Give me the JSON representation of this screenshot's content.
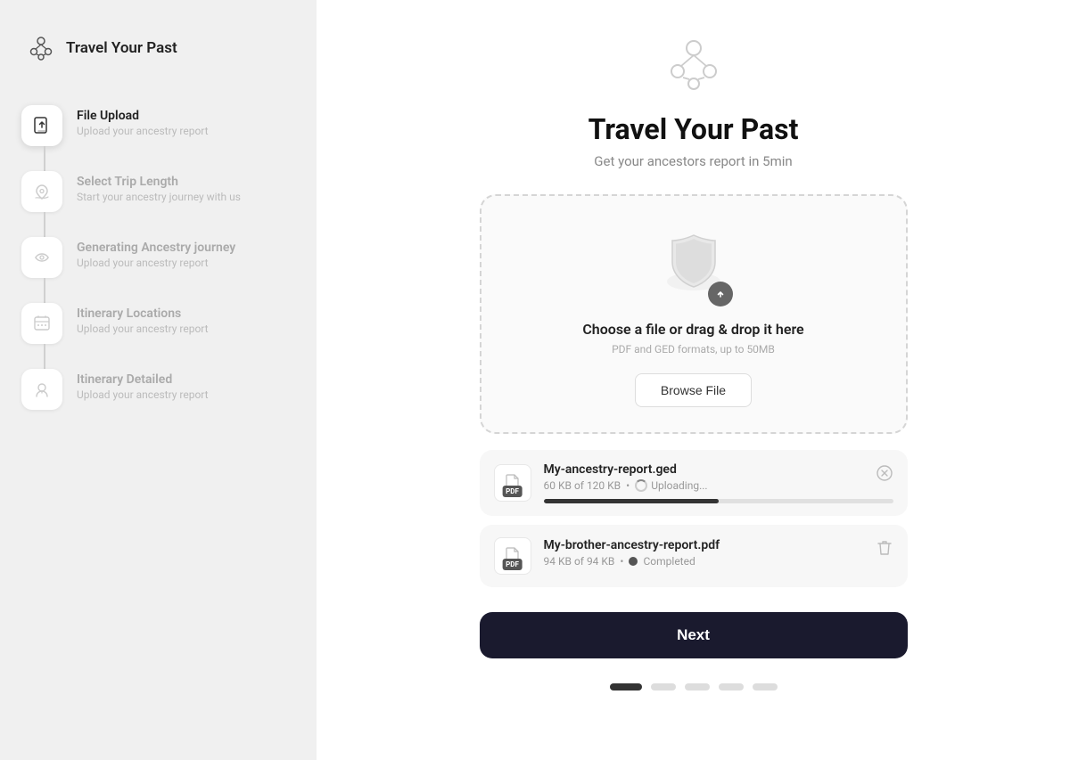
{
  "app": {
    "name": "Travel Your Past"
  },
  "sidebar": {
    "steps": [
      {
        "id": "file-upload",
        "title": "File Upload",
        "subtitle": "Upload your ancestry report",
        "active": true,
        "icon": "upload-icon"
      },
      {
        "id": "select-trip",
        "title": "Select Trip Length",
        "subtitle": "Start your ancestry journey with us",
        "active": false,
        "icon": "island-icon"
      },
      {
        "id": "generating",
        "title": "Generating Ancestry journey",
        "subtitle": "Upload your ancestry report",
        "active": false,
        "icon": "route-icon"
      },
      {
        "id": "itinerary-locations",
        "title": "Itinerary Locations",
        "subtitle": "Upload your ancestry report",
        "active": false,
        "icon": "map-icon"
      },
      {
        "id": "itinerary-detailed",
        "title": "Itinerary Detailed",
        "subtitle": "Upload your ancestry report",
        "active": false,
        "icon": "person-pin-icon"
      }
    ]
  },
  "main": {
    "title": "Travel Your Past",
    "subtitle": "Get your ancestors report in 5min",
    "dropzone": {
      "title": "Choose a file or drag & drop it here",
      "hint": "PDF and GED formats, up to 50MB",
      "browse_label": "Browse File"
    },
    "files": [
      {
        "name": "My-ancestry-report.ged",
        "size": "60 KB of 120 KB",
        "status": "uploading",
        "status_label": "Uploading...",
        "progress": 50,
        "type": "PDF"
      },
      {
        "name": "My-brother-ancestry-report.pdf",
        "size": "94 KB of 94 KB",
        "status": "completed",
        "status_label": "Completed",
        "progress": 100,
        "type": "PDF"
      }
    ],
    "next_label": "Next",
    "pagination": {
      "total": 5,
      "active": 0
    }
  }
}
